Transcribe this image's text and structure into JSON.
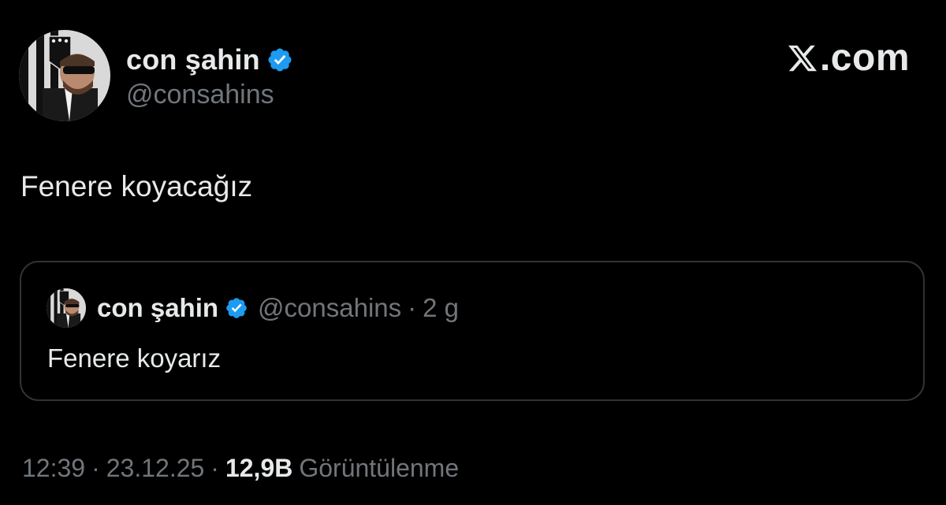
{
  "author": {
    "display_name": "con şahin",
    "handle": "@consahins",
    "avatar_icon": "user-avatar",
    "verified_icon": "verified-badge-icon",
    "verified_color": "#1d9bf0"
  },
  "brand": {
    "icon": "x-logo-icon",
    "suffix": ".com"
  },
  "tweet": {
    "text": "Fenere koyacağız"
  },
  "quoted_tweet": {
    "display_name": "con şahin",
    "handle": "@consahins",
    "separator": "·",
    "time": "2 g",
    "text": "Fenere koyarız"
  },
  "meta": {
    "time": "12:39",
    "separator": "·",
    "date": "23.12.25",
    "views_count": "12,9B",
    "views_label": "Görüntülenme"
  },
  "colors": {
    "background": "#000000",
    "primary_text": "#e7e9ea",
    "secondary_text": "#71767b",
    "border": "#2f3336"
  }
}
